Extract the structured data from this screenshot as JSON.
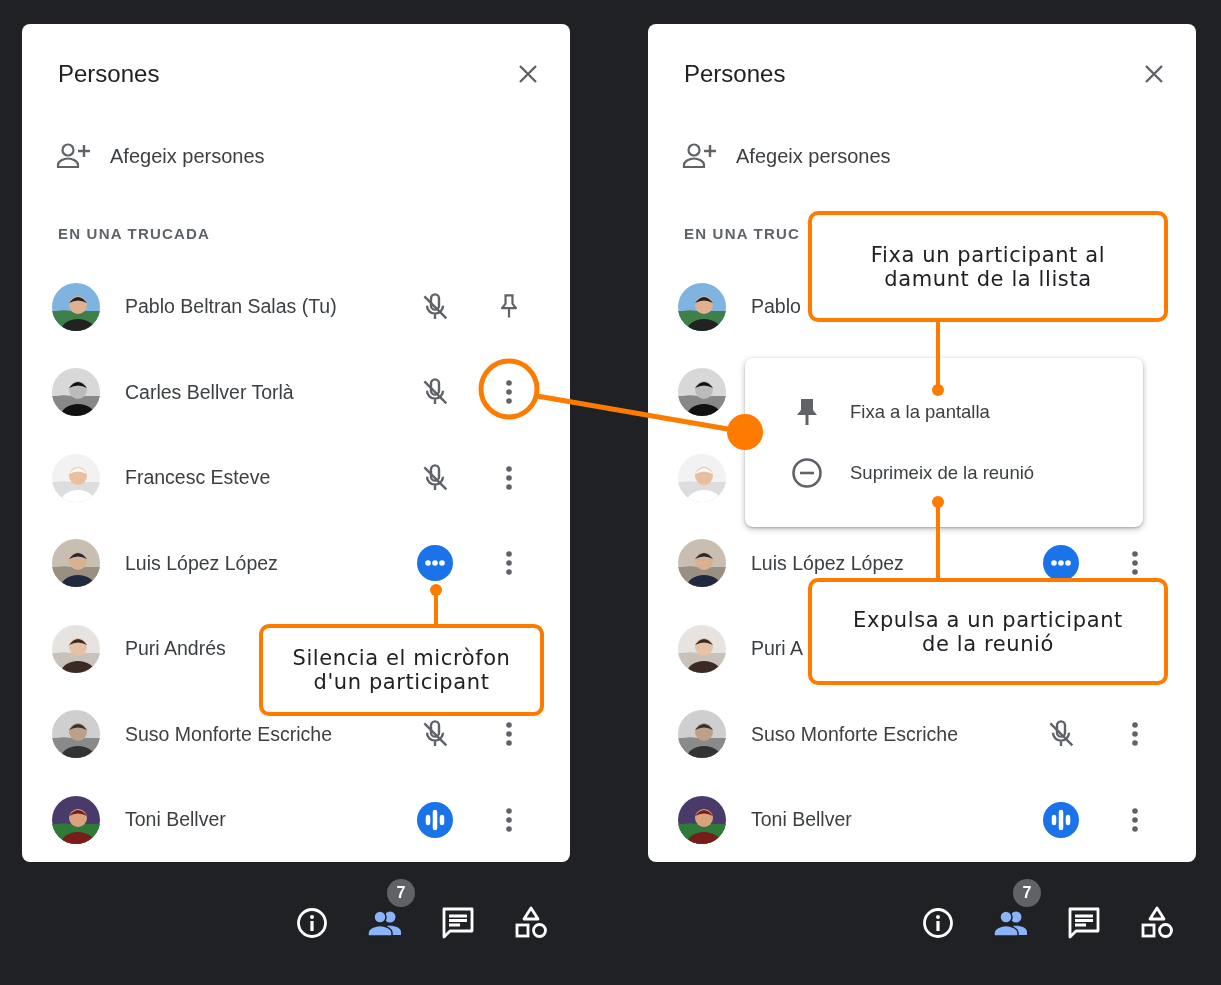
{
  "panels": [
    {
      "title": "Persones",
      "add_label": "Afegeix persones",
      "section": "EN UNA TRUCADA",
      "participants": [
        {
          "avatar": {
            "kind": "picture"
          },
          "name": "Pablo Beltran Salas (Tu)",
          "mic": {
            "kind": "muted"
          },
          "action": {
            "kind": "pin"
          }
        },
        {
          "avatar": {
            "kind": "picture"
          },
          "name": "Carles Bellver Torlà",
          "mic": {
            "kind": "muted"
          },
          "action": {
            "kind": "more"
          }
        },
        {
          "avatar": {
            "kind": "picture"
          },
          "name": "Francesc Esteve",
          "mic": {
            "kind": "muted"
          },
          "action": {
            "kind": "more"
          }
        },
        {
          "avatar": {
            "kind": "picture"
          },
          "name": "Luis López López",
          "mic": {
            "kind": "dots"
          },
          "action": {
            "kind": "more"
          }
        },
        {
          "avatar": {
            "kind": "picture"
          },
          "name": "Puri Andrés"
        },
        {
          "avatar": {
            "kind": "picture"
          },
          "name": "Suso Monforte Escriche",
          "mic": {
            "kind": "muted"
          },
          "action": {
            "kind": "more"
          }
        },
        {
          "avatar": {
            "kind": "picture"
          },
          "name": "Toni Bellver",
          "mic": {
            "kind": "speaking"
          },
          "action": {
            "kind": "more"
          }
        }
      ],
      "toolbar": [
        {
          "kind": "info",
          "selected": false
        },
        {
          "kind": "people",
          "selected": true,
          "badge": "7"
        },
        {
          "kind": "chat",
          "selected": false
        },
        {
          "kind": "activities",
          "selected": false
        }
      ]
    },
    {
      "title": "Persones",
      "add_label": "Afegeix persones",
      "section": "EN UNA TRUC",
      "participants": [
        {
          "avatar": {
            "kind": "picture"
          },
          "name": "Pablo"
        },
        {
          "avatar": {
            "kind": "picture"
          }
        },
        {
          "avatar": {
            "kind": "picture"
          }
        },
        {
          "avatar": {
            "kind": "picture"
          },
          "name": "Luis López López",
          "mic": {
            "kind": "dots"
          },
          "action": {
            "kind": "more"
          }
        },
        {
          "avatar": {
            "kind": "picture"
          },
          "name": "Puri A"
        },
        {
          "avatar": {
            "kind": "picture"
          },
          "name": "Suso Monforte Escriche",
          "mic": {
            "kind": "muted"
          },
          "action": {
            "kind": "more"
          }
        },
        {
          "avatar": {
            "kind": "picture"
          },
          "name": "Toni Bellver",
          "mic": {
            "kind": "speaking"
          },
          "action": {
            "kind": "more"
          }
        }
      ],
      "menu": {
        "items": [
          {
            "kind": "pin",
            "label": "Fixa a la pantalla"
          },
          {
            "kind": "remove",
            "label": "Suprimeix de la reunió"
          }
        ]
      },
      "toolbar": [
        {
          "kind": "info",
          "selected": false
        },
        {
          "kind": "people",
          "selected": true,
          "badge": "7"
        },
        {
          "kind": "chat",
          "selected": false
        },
        {
          "kind": "activities",
          "selected": false
        }
      ]
    }
  ],
  "callouts": [
    {
      "text": "Silencia el micròfon d'un participant"
    },
    {
      "text": "Fixa un participant al damunt de la llista"
    },
    {
      "text": "Expulsa a un participant de la reunió"
    }
  ]
}
